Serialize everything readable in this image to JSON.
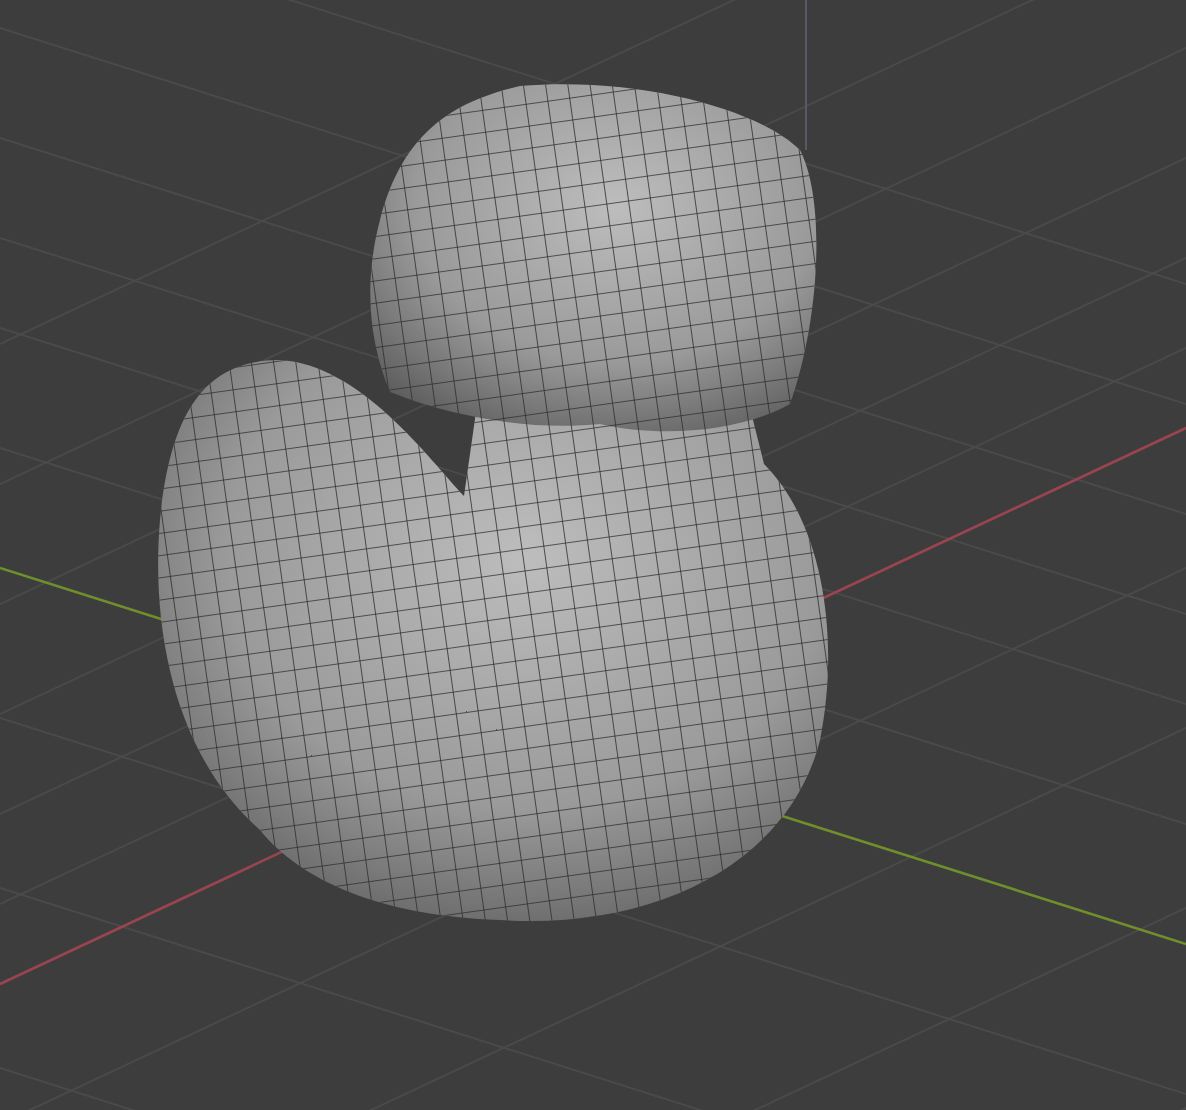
{
  "viewport": {
    "axes": [
      {
        "kind": "x",
        "color": "#9a4450"
      },
      {
        "kind": "y",
        "color": "#6f8f2c"
      }
    ]
  }
}
